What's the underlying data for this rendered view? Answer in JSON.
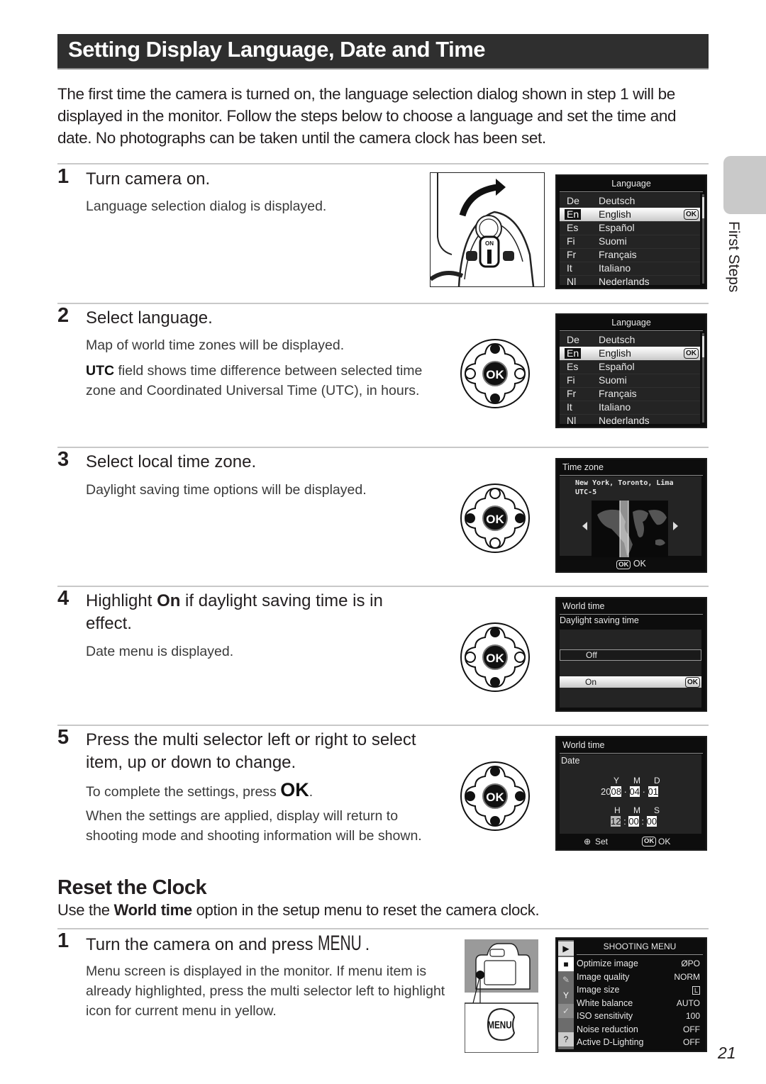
{
  "page": {
    "title": "Setting Display Language, Date and Time",
    "intro": "The first time the camera is turned on, the language selection dialog shown in step 1 will be displayed in the monitor. Follow the steps below to choose a language and set the time and date. No photographs can be taken until the camera clock has been set.",
    "side_tab_label": "First Steps",
    "page_number": "21"
  },
  "steps": [
    {
      "num": "1",
      "title": "Turn camera on.",
      "body": [
        "Language selection dialog is displayed."
      ]
    },
    {
      "num": "2",
      "title": "Select language.",
      "body": [
        "Map of world time zones will be displayed."
      ],
      "utc_bold": "UTC",
      "utc_rest": " field shows time difference between selected time zone and Coordinated Universal Time (UTC), in hours."
    },
    {
      "num": "3",
      "title": "Select local time zone.",
      "body": [
        "Daylight saving time options will be displayed."
      ]
    },
    {
      "num": "4",
      "title_pre": "Highlight ",
      "title_bold": "On",
      "title_post": " if daylight saving time is in effect.",
      "body": [
        "Date menu is displayed."
      ]
    },
    {
      "num": "5",
      "title": "Press the multi selector left or right to select item, up or down to change.",
      "body_pre": "To complete the settings, press ",
      "body_ok": "OK",
      "body_post": ".",
      "body2": "When the settings are applied, display will return to shooting mode and shooting information will be shown."
    }
  ],
  "reset": {
    "heading": "Reset the Clock",
    "text_pre": "Use the ",
    "text_bold": "World time",
    "text_post": " option in the setup menu to reset the camera clock.",
    "step": {
      "num": "1",
      "title_pre": "Turn the camera on and press ",
      "title_key": "MENU",
      "title_post": ".",
      "body": "Menu screen is displayed in the monitor. If menu item is already highlighted, press the multi selector left to highlight icon for current menu in yellow."
    }
  },
  "illustrations": {
    "power_switch_label": "ON",
    "dpad_center": "OK",
    "menu_button": "MENU"
  },
  "screens": {
    "language": {
      "title": "Language",
      "ok_badge": "OK",
      "rows": [
        {
          "code": "De",
          "name": "Deutsch"
        },
        {
          "code": "En",
          "name": "English",
          "selected": true
        },
        {
          "code": "Es",
          "name": "Español"
        },
        {
          "code": "Fi",
          "name": "Suomi"
        },
        {
          "code": "Fr",
          "name": "Français"
        },
        {
          "code": "It",
          "name": "Italiano"
        },
        {
          "code": "Nl",
          "name": "Nederlands"
        }
      ]
    },
    "timezone": {
      "title": "Time zone",
      "city": "New York, Toronto, Lima",
      "utc": "UTC-5",
      "footer_badge": "OK",
      "footer_label": "OK"
    },
    "dst": {
      "title": "World time",
      "subtitle": "Daylight saving time",
      "options": [
        "Off",
        "On"
      ],
      "selected": "On",
      "ok_badge": "OK"
    },
    "date": {
      "title": "World time",
      "subtitle": "Date",
      "date_labels": [
        "Y",
        "M",
        "D"
      ],
      "year_prefix": "20",
      "year": "08",
      "month": "04",
      "day": "01",
      "time_labels": [
        "H",
        "M",
        "S"
      ],
      "hour": "12",
      "minute": "00",
      "second": "00",
      "footer_set": "Set",
      "footer_badge": "OK",
      "footer_ok": "OK"
    },
    "shooting_menu": {
      "title": "SHOOTING MENU",
      "rows": [
        {
          "label": "Optimize image",
          "value": "ØPO"
        },
        {
          "label": "Image quality",
          "value": "NORM"
        },
        {
          "label": "Image size",
          "value": "L"
        },
        {
          "label": "White balance",
          "value": "AUTO"
        },
        {
          "label": "ISO sensitivity",
          "value": "100"
        },
        {
          "label": "Noise reduction",
          "value": "OFF"
        },
        {
          "label": "Active D-Lighting",
          "value": "OFF"
        }
      ],
      "side_icons": [
        "playback-icon",
        "camera-icon",
        "pencil-icon",
        "wrench-icon",
        "retouch-icon",
        "help-icon"
      ],
      "help_glyph": "?"
    }
  }
}
